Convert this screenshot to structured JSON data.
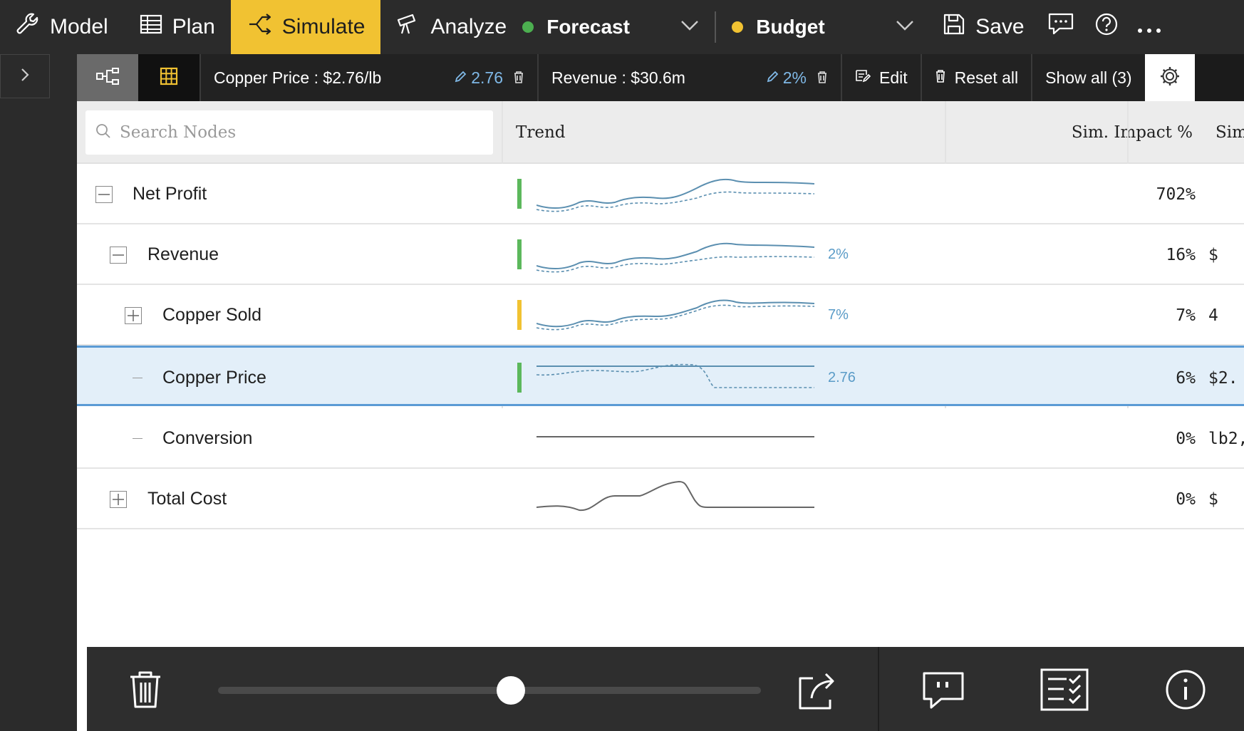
{
  "toolbar": {
    "model_label": "Model",
    "plan_label": "Plan",
    "simulate_label": "Simulate",
    "analyze_label": "Analyze",
    "scenario_1": {
      "label": "Forecast",
      "color": "#4caf50"
    },
    "scenario_2": {
      "label": "Budget",
      "color": "#f1c232"
    },
    "save_label": "Save",
    "accent_color": "#f1c232"
  },
  "filterbar": {
    "chips": [
      {
        "label": "Copper Price : $2.76/lb",
        "value": "2.76"
      },
      {
        "label": "Revenue : $30.6m",
        "value": "2%"
      }
    ],
    "edit_label": "Edit",
    "reset_label": "Reset all",
    "show_all_label": "Show all (3)"
  },
  "table": {
    "search_placeholder": "Search Nodes",
    "columns": {
      "trend": "Trend",
      "impact": "Sim. Impact %",
      "sim": "Sim. I"
    },
    "rows": [
      {
        "name": "Net Profit",
        "delta": "",
        "impact": "702%",
        "sim": ""
      },
      {
        "name": "Revenue",
        "delta": "2%",
        "impact": "16%",
        "sim": "$"
      },
      {
        "name": "Copper Sold",
        "delta": "7%",
        "impact": "7%",
        "sim": "4"
      },
      {
        "name": "Copper Price",
        "delta": "2.76",
        "impact": "6%",
        "sim": "$2."
      },
      {
        "name": "Conversion",
        "delta": "",
        "impact": "0%",
        "sim": "lb2,"
      },
      {
        "name": "Total Cost",
        "delta": "",
        "impact": "0%",
        "sim": "$"
      }
    ]
  },
  "bottombar": {
    "slider_value": 0.54
  },
  "icons": {
    "model": "wrench-icon",
    "plan": "table-icon",
    "simulate": "simulate-icon",
    "analyze": "telescope-icon",
    "save": "floppy-disk-icon",
    "comment": "comment-icon",
    "help": "help-icon",
    "more": "more-icon"
  }
}
